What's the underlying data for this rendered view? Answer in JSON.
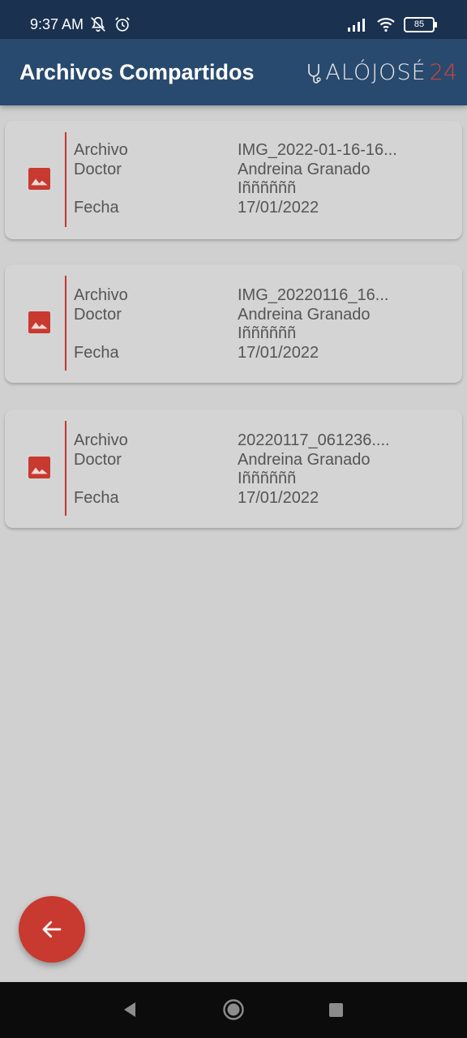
{
  "status_bar": {
    "time": "9:37 AM",
    "battery": "85"
  },
  "app_bar": {
    "title": "Archivos Compartidos",
    "logo_text": "ALÓJOSÉ",
    "logo_number": "24"
  },
  "files": [
    {
      "archivo_label": "Archivo",
      "archivo": "IMG_2022-01-16-16...",
      "doctor_label": "Doctor",
      "doctor": "Andreina Granado",
      "doctor_extra": "Iññññññ",
      "fecha_label": "Fecha",
      "fecha": "17/01/2022"
    },
    {
      "archivo_label": "Archivo",
      "archivo": "IMG_20220116_16...",
      "doctor_label": "Doctor",
      "doctor": "Andreina Granado",
      "doctor_extra": "Iññññññ",
      "fecha_label": "Fecha",
      "fecha": "17/01/2022"
    },
    {
      "archivo_label": "Archivo",
      "archivo": "20220117_061236....",
      "doctor_label": "Doctor",
      "doctor": "Andreina Granado",
      "doctor_extra": "Iññññññ",
      "fecha_label": "Fecha",
      "fecha": "17/01/2022"
    }
  ],
  "icons": {
    "file_type": "image-icon",
    "fab": "arrow-back-icon"
  },
  "colors": {
    "app_bar": "#284a6e",
    "status_bar": "#1a3150",
    "accent": "#c8392f",
    "background": "#d0d0d0"
  }
}
